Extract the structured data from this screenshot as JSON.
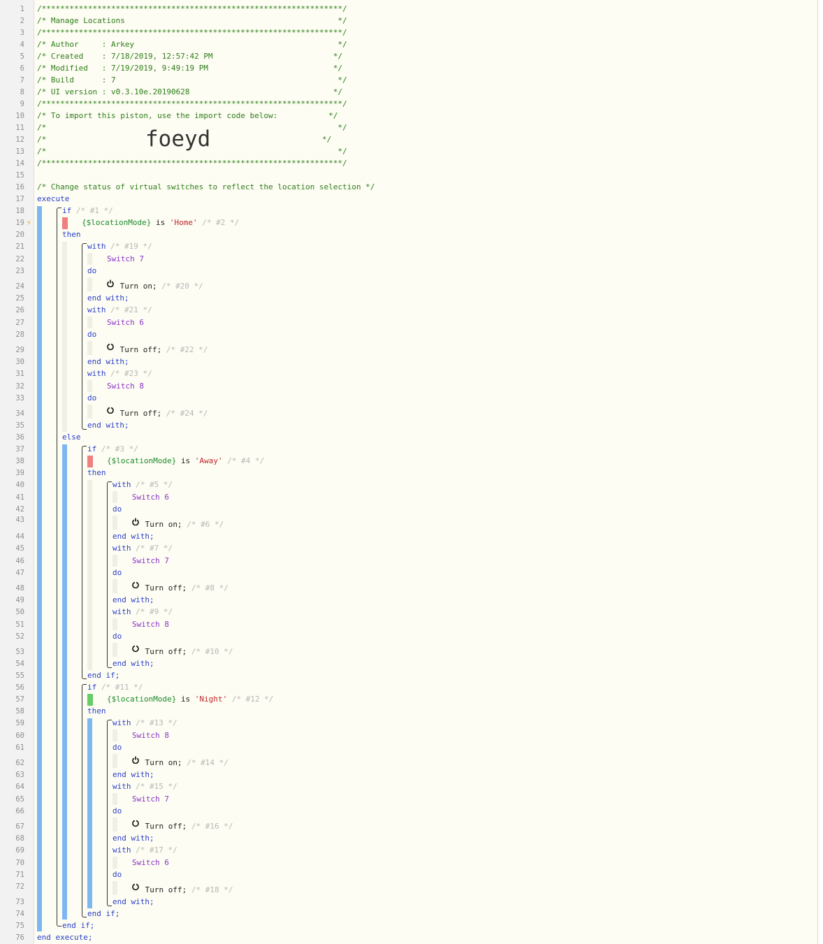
{
  "line_numbers": [
    "1",
    "2",
    "3",
    "4",
    "5",
    "6",
    "7",
    "8",
    "9",
    "10",
    "11",
    "12",
    "13",
    "14",
    "15",
    "16",
    "17",
    "18",
    "19",
    "20",
    "21",
    "22",
    "23",
    "24",
    "25",
    "26",
    "27",
    "28",
    "29",
    "30",
    "31",
    "32",
    "33",
    "34",
    "35",
    "36",
    "37",
    "38",
    "39",
    "40",
    "41",
    "42",
    "43",
    "44",
    "45",
    "46",
    "47",
    "48",
    "49",
    "50",
    "51",
    "52",
    "53",
    "54",
    "55",
    "56",
    "57",
    "58",
    "59",
    "60",
    "61",
    "62",
    "63",
    "64",
    "65",
    "66",
    "67",
    "68",
    "69",
    "70",
    "71",
    "72",
    "73",
    "74",
    "75",
    "76"
  ],
  "header": {
    "border": "/*****************************************************************/",
    "title": "/* Manage Locations                                              */",
    "author": "/* Author     : Arkey                                            */",
    "created": "/* Created    : 7/18/2019, 12:57:42 PM                          */",
    "modified": "/* Modified   : 7/19/2019, 9:49:19 PM                           */",
    "build": "/* Build      : 7                                                */",
    "ui_version": "/* UI version : v0.3.10e.20190628                               */",
    "import_note": "/* To import this piston, use the import code below:           */",
    "blank": "/*                                                               */",
    "blank_left": "/*",
    "blank_right": "*/",
    "import_code": "foeyd"
  },
  "colors": {
    "blue_bar": "#7db7f0",
    "false_condition": "#f08080",
    "true_condition": "#66cc66",
    "trigger": "#f0a030"
  },
  "icons": {
    "trigger": "lightning-icon",
    "on": "power-on-icon",
    "off": "power-off-icon"
  },
  "code": {
    "comment_main": "/* Change status of virtual switches to reflect the location selection */",
    "execute": "execute",
    "end_execute": "end execute;",
    "if_kw": "if",
    "then_kw": "then",
    "else_kw": "else",
    "end_if": "end if;",
    "with_kw": "with",
    "do_kw": "do",
    "end_with": "end with;",
    "location_var": "{$locationMode}",
    "is_op": " is ",
    "turn_on": " Turn on;",
    "turn_off": " Turn off;",
    "c1": " /* #1 */",
    "c2": " /* #2 */",
    "c3": " /* #3 */",
    "c4": " /* #4 */",
    "c5": " /* #5 */",
    "c6": " /* #6 */",
    "c7": " /* #7 */",
    "c8": " /* #8 */",
    "c9": " /* #9 */",
    "c10": " /* #10 */",
    "c11": " /* #11 */",
    "c12": " /* #12 */",
    "c13": " /* #13 */",
    "c14": " /* #14 */",
    "c15": " /* #15 */",
    "c16": " /* #16 */",
    "c17": " /* #17 */",
    "c18": " /* #18 */",
    "c19": " /* #19 */",
    "c20": " /* #20 */",
    "c21": " /* #21 */",
    "c22": " /* #22 */",
    "c23": " /* #23 */",
    "c24": " /* #24 */",
    "home": "'Home'",
    "away": "'Away'",
    "night": "'Night'",
    "switch6": "Switch 6",
    "switch7": "Switch 7",
    "switch8": "Switch 8"
  }
}
